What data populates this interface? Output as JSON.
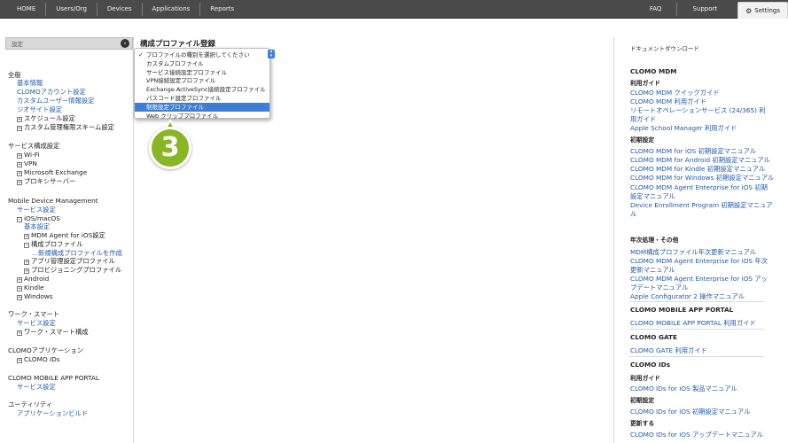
{
  "nav": {
    "left": [
      "HOME",
      "Users/Org",
      "Devices",
      "Applications",
      "Reports"
    ],
    "right": [
      "FAQ",
      "Support"
    ],
    "settings": "Settings"
  },
  "sidebar": {
    "header": "設定",
    "rows": [
      {
        "text": "全般",
        "kind": "sec",
        "indent": 0
      },
      {
        "text": "基本情報",
        "kind": "lnk",
        "indent": 1
      },
      {
        "text": "CLOMOアカウント設定",
        "kind": "lnk",
        "indent": 1
      },
      {
        "text": "カスタムユーザー情報設定",
        "kind": "lnk",
        "indent": 1
      },
      {
        "text": "ジオサイト設定",
        "kind": "lnk",
        "indent": 1
      },
      {
        "text": "スケジュール設定",
        "kind": "txt",
        "indent": 1,
        "box": "+"
      },
      {
        "text": "カスタム管理権限スキーム設定",
        "kind": "txt",
        "indent": 1,
        "box": "+"
      },
      {
        "text": "サービス構成設定",
        "kind": "sec",
        "indent": 0
      },
      {
        "text": "Wi-Fi",
        "kind": "txt",
        "indent": 1,
        "box": "+"
      },
      {
        "text": "VPN",
        "kind": "txt",
        "indent": 1,
        "box": "+"
      },
      {
        "text": "Microsoft Exchange",
        "kind": "txt",
        "indent": 1,
        "box": "+"
      },
      {
        "text": "プロキシサーバー",
        "kind": "txt",
        "indent": 1,
        "box": "+"
      },
      {
        "text": "Mobile Device Management",
        "kind": "sec",
        "indent": 0
      },
      {
        "text": "サービス設定",
        "kind": "lnk",
        "indent": 1
      },
      {
        "text": "iOS/macOS",
        "kind": "txt",
        "indent": 1,
        "box": "-"
      },
      {
        "text": "基本設定",
        "kind": "lnk",
        "indent": 2
      },
      {
        "text": "MDM Agent for iOS設定",
        "kind": "txt",
        "indent": 2,
        "box": "+"
      },
      {
        "text": "構成プロファイル",
        "kind": "txt",
        "indent": 2,
        "box": "-"
      },
      {
        "text": "...新規構成プロファイルを作成",
        "kind": "lnk",
        "indent": 3
      },
      {
        "text": "アプリ管理設定プロファイル",
        "kind": "txt",
        "indent": 2,
        "box": "+"
      },
      {
        "text": "プロビジョニングプロファイル",
        "kind": "txt",
        "indent": 2,
        "box": "+"
      },
      {
        "text": "Android",
        "kind": "txt",
        "indent": 1,
        "box": "+"
      },
      {
        "text": "Kindle",
        "kind": "txt",
        "indent": 1,
        "box": "+"
      },
      {
        "text": "Windows",
        "kind": "txt",
        "indent": 1,
        "box": "+"
      },
      {
        "text": "ワーク・スマート",
        "kind": "sec",
        "indent": 0
      },
      {
        "text": "サービス設定",
        "kind": "lnk",
        "indent": 1
      },
      {
        "text": "ワーク・スマート構成",
        "kind": "txt",
        "indent": 1,
        "box": "+"
      },
      {
        "text": "CLOMOアプリケーション",
        "kind": "sec",
        "indent": 0
      },
      {
        "text": "CLOMO IDs",
        "kind": "txt",
        "indent": 1,
        "box": "+"
      },
      {
        "text": "CLOMO MOBILE APP PORTAL",
        "kind": "sec",
        "indent": 0
      },
      {
        "text": "サービス設定",
        "kind": "lnk",
        "indent": 1
      },
      {
        "text": "ユーティリティ",
        "kind": "sec",
        "indent": 0
      },
      {
        "text": "アプリケーションビルド",
        "kind": "lnk",
        "indent": 1
      }
    ]
  },
  "main": {
    "title": "構成プロファイル登録",
    "dropdown": {
      "options": [
        "プロファイルの種別を選択してください",
        "カスタムプロファイル",
        "サービス接続設定プロファイル",
        "VPN接続設定プロファイル",
        "Exchange ActiveSync接続設定プロファイル",
        "パスコード設定プロファイル",
        "制限設定プロファイル",
        "Web クリッププロファイル"
      ],
      "checked_index": 0,
      "highlighted_index": 6
    },
    "step_badge": "3"
  },
  "downloads": {
    "title": "ドキュメントダウンロード",
    "items": [
      {
        "text": "CLOMO MDM",
        "kind": "r-head"
      },
      {
        "text": "利用ガイド",
        "kind": "r-sub"
      },
      {
        "text": "CLOMO MDM クイックガイド",
        "kind": "r-link"
      },
      {
        "text": "CLOMO MDM 利用ガイド",
        "kind": "r-link"
      },
      {
        "text": "リモートオペレーションサービス (24/365) 利",
        "kind": "r-link"
      },
      {
        "text": "用ガイド",
        "kind": "r-link"
      },
      {
        "text": "Apple School Manager 利用ガイド",
        "kind": "r-link"
      },
      {
        "text": "初期設定",
        "kind": "r-sub"
      },
      {
        "text": "CLOMO MDM for iOS 初期設定マニュアル",
        "kind": "r-link"
      },
      {
        "text": "CLOMO MDM for Android 初期設定マニュアル",
        "kind": "r-link"
      },
      {
        "text": "CLOMO MDM for Kindle 初期設定マニュアル",
        "kind": "r-link"
      },
      {
        "text": "CLOMO MDM for Windows 初期設定マニュアル",
        "kind": "r-link"
      },
      {
        "text": "CLOMO MDM Agent Enterprise for iOS 初期",
        "kind": "r-link"
      },
      {
        "text": "設定マニュアル",
        "kind": "r-link"
      },
      {
        "text": "Device Enrollment Program 初期設定マニュア",
        "kind": "r-link"
      },
      {
        "text": "ル",
        "kind": "r-link"
      },
      {
        "text": "年次処理・その他",
        "kind": "r-sub"
      },
      {
        "text": "MDM構成プロファイル年次更新マニュアル",
        "kind": "r-link"
      },
      {
        "text": "CLOMO MDM Agent Enterprise for iOS 年次",
        "kind": "r-link"
      },
      {
        "text": "更新マニュアル",
        "kind": "r-link"
      },
      {
        "text": "CLOMO MDM Agent Enterprise for iOS アッ",
        "kind": "r-link"
      },
      {
        "text": "プデートマニュアル",
        "kind": "r-link"
      },
      {
        "text": "Apple Configurator 2 操作マニュアル",
        "kind": "r-link"
      },
      {
        "text": "CLOMO MOBILE APP PORTAL",
        "kind": "r-head"
      },
      {
        "text": "CLOMO MOBILE APP PORTAL 利用ガイド",
        "kind": "r-link"
      },
      {
        "text": "CLOMO GATE",
        "kind": "r-head"
      },
      {
        "text": "CLOMO GATE 利用ガイド",
        "kind": "r-link"
      },
      {
        "text": "CLOMO IDs",
        "kind": "r-head"
      },
      {
        "text": "利用ガイド",
        "kind": "r-sub"
      },
      {
        "text": "CLOMO IDs for iOS 製品マニュアル",
        "kind": "r-link"
      },
      {
        "text": "初期設定",
        "kind": "r-sub"
      },
      {
        "text": "CLOMO IDs for iOS 初期設定マニュアル",
        "kind": "r-link"
      },
      {
        "text": "更新する",
        "kind": "r-sub"
      },
      {
        "text": "CLOMO IDs for iOS アップデートマニュアル",
        "kind": "r-link"
      }
    ]
  }
}
